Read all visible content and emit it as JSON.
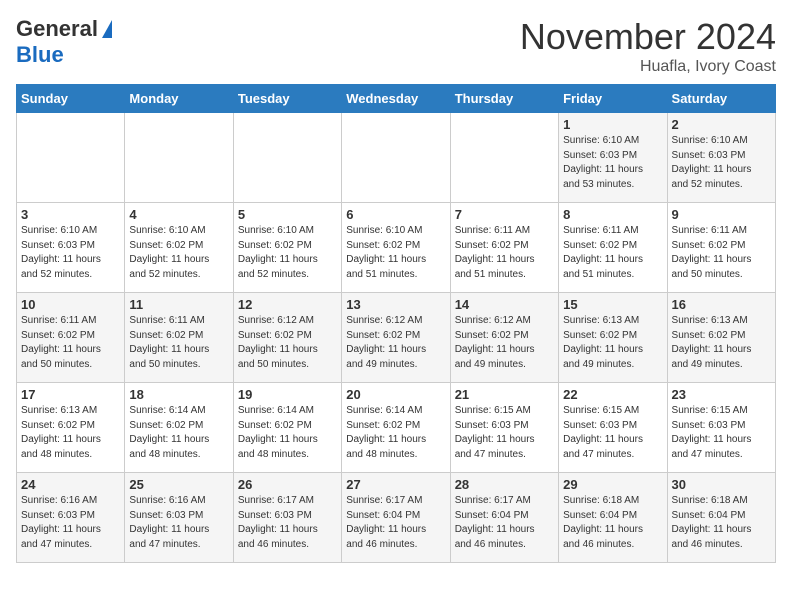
{
  "header": {
    "logo_general": "General",
    "logo_blue": "Blue",
    "month_title": "November 2024",
    "location": "Huafla, Ivory Coast"
  },
  "calendar": {
    "weekdays": [
      "Sunday",
      "Monday",
      "Tuesday",
      "Wednesday",
      "Thursday",
      "Friday",
      "Saturday"
    ],
    "weeks": [
      [
        {
          "day": "",
          "info": ""
        },
        {
          "day": "",
          "info": ""
        },
        {
          "day": "",
          "info": ""
        },
        {
          "day": "",
          "info": ""
        },
        {
          "day": "",
          "info": ""
        },
        {
          "day": "1",
          "info": "Sunrise: 6:10 AM\nSunset: 6:03 PM\nDaylight: 11 hours\nand 53 minutes."
        },
        {
          "day": "2",
          "info": "Sunrise: 6:10 AM\nSunset: 6:03 PM\nDaylight: 11 hours\nand 52 minutes."
        }
      ],
      [
        {
          "day": "3",
          "info": "Sunrise: 6:10 AM\nSunset: 6:03 PM\nDaylight: 11 hours\nand 52 minutes."
        },
        {
          "day": "4",
          "info": "Sunrise: 6:10 AM\nSunset: 6:02 PM\nDaylight: 11 hours\nand 52 minutes."
        },
        {
          "day": "5",
          "info": "Sunrise: 6:10 AM\nSunset: 6:02 PM\nDaylight: 11 hours\nand 52 minutes."
        },
        {
          "day": "6",
          "info": "Sunrise: 6:10 AM\nSunset: 6:02 PM\nDaylight: 11 hours\nand 51 minutes."
        },
        {
          "day": "7",
          "info": "Sunrise: 6:11 AM\nSunset: 6:02 PM\nDaylight: 11 hours\nand 51 minutes."
        },
        {
          "day": "8",
          "info": "Sunrise: 6:11 AM\nSunset: 6:02 PM\nDaylight: 11 hours\nand 51 minutes."
        },
        {
          "day": "9",
          "info": "Sunrise: 6:11 AM\nSunset: 6:02 PM\nDaylight: 11 hours\nand 50 minutes."
        }
      ],
      [
        {
          "day": "10",
          "info": "Sunrise: 6:11 AM\nSunset: 6:02 PM\nDaylight: 11 hours\nand 50 minutes."
        },
        {
          "day": "11",
          "info": "Sunrise: 6:11 AM\nSunset: 6:02 PM\nDaylight: 11 hours\nand 50 minutes."
        },
        {
          "day": "12",
          "info": "Sunrise: 6:12 AM\nSunset: 6:02 PM\nDaylight: 11 hours\nand 50 minutes."
        },
        {
          "day": "13",
          "info": "Sunrise: 6:12 AM\nSunset: 6:02 PM\nDaylight: 11 hours\nand 49 minutes."
        },
        {
          "day": "14",
          "info": "Sunrise: 6:12 AM\nSunset: 6:02 PM\nDaylight: 11 hours\nand 49 minutes."
        },
        {
          "day": "15",
          "info": "Sunrise: 6:13 AM\nSunset: 6:02 PM\nDaylight: 11 hours\nand 49 minutes."
        },
        {
          "day": "16",
          "info": "Sunrise: 6:13 AM\nSunset: 6:02 PM\nDaylight: 11 hours\nand 49 minutes."
        }
      ],
      [
        {
          "day": "17",
          "info": "Sunrise: 6:13 AM\nSunset: 6:02 PM\nDaylight: 11 hours\nand 48 minutes."
        },
        {
          "day": "18",
          "info": "Sunrise: 6:14 AM\nSunset: 6:02 PM\nDaylight: 11 hours\nand 48 minutes."
        },
        {
          "day": "19",
          "info": "Sunrise: 6:14 AM\nSunset: 6:02 PM\nDaylight: 11 hours\nand 48 minutes."
        },
        {
          "day": "20",
          "info": "Sunrise: 6:14 AM\nSunset: 6:02 PM\nDaylight: 11 hours\nand 48 minutes."
        },
        {
          "day": "21",
          "info": "Sunrise: 6:15 AM\nSunset: 6:03 PM\nDaylight: 11 hours\nand 47 minutes."
        },
        {
          "day": "22",
          "info": "Sunrise: 6:15 AM\nSunset: 6:03 PM\nDaylight: 11 hours\nand 47 minutes."
        },
        {
          "day": "23",
          "info": "Sunrise: 6:15 AM\nSunset: 6:03 PM\nDaylight: 11 hours\nand 47 minutes."
        }
      ],
      [
        {
          "day": "24",
          "info": "Sunrise: 6:16 AM\nSunset: 6:03 PM\nDaylight: 11 hours\nand 47 minutes."
        },
        {
          "day": "25",
          "info": "Sunrise: 6:16 AM\nSunset: 6:03 PM\nDaylight: 11 hours\nand 47 minutes."
        },
        {
          "day": "26",
          "info": "Sunrise: 6:17 AM\nSunset: 6:03 PM\nDaylight: 11 hours\nand 46 minutes."
        },
        {
          "day": "27",
          "info": "Sunrise: 6:17 AM\nSunset: 6:04 PM\nDaylight: 11 hours\nand 46 minutes."
        },
        {
          "day": "28",
          "info": "Sunrise: 6:17 AM\nSunset: 6:04 PM\nDaylight: 11 hours\nand 46 minutes."
        },
        {
          "day": "29",
          "info": "Sunrise: 6:18 AM\nSunset: 6:04 PM\nDaylight: 11 hours\nand 46 minutes."
        },
        {
          "day": "30",
          "info": "Sunrise: 6:18 AM\nSunset: 6:04 PM\nDaylight: 11 hours\nand 46 minutes."
        }
      ]
    ]
  }
}
